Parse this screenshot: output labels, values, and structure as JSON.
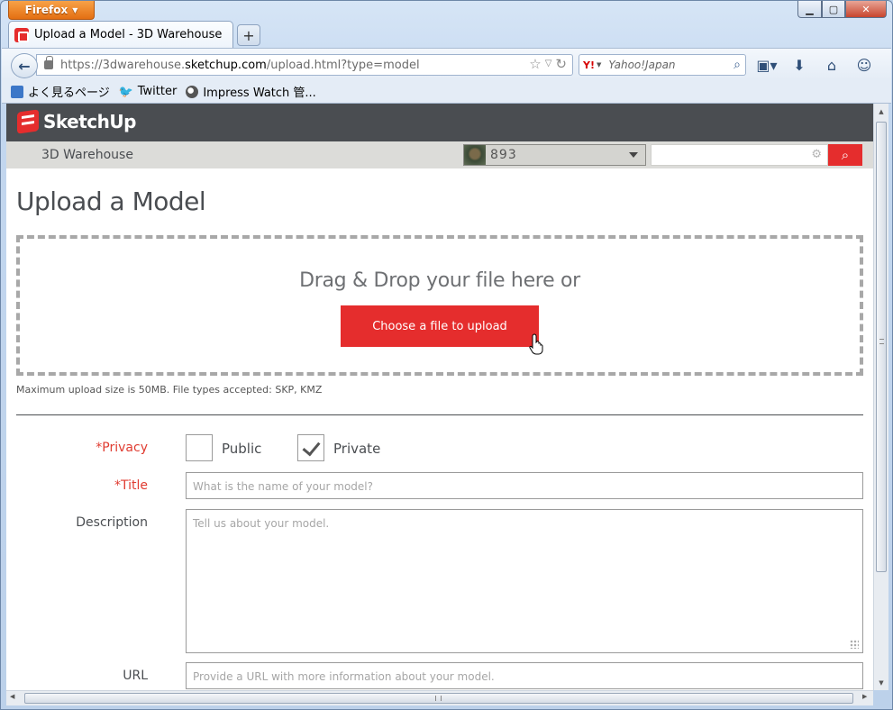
{
  "browser": {
    "menu_button": "Firefox",
    "tab_title": "Upload a Model - 3D Warehouse",
    "new_tab": "+",
    "url_prefix": "https://3dwarehouse.",
    "url_host": "sketchup.com",
    "url_path": "/upload.html?type=model",
    "search_engine": "Y!",
    "search_placeholder": "Yahoo!Japan",
    "bookmarks": [
      {
        "label": "よく見るページ",
        "icon": "bookmark-icon"
      },
      {
        "label": "Twitter",
        "icon": "twitter-icon"
      },
      {
        "label": "Impress Watch 管...",
        "icon": "impress-icon"
      }
    ]
  },
  "site": {
    "logo_text": "SketchUp",
    "section_title": "3D Warehouse",
    "user_name": "893",
    "brand_color": "#e52d2d"
  },
  "upload": {
    "page_title": "Upload a Model",
    "drop_text": "Drag & Drop your file here or",
    "choose_button": "Choose a file to upload",
    "note": "Maximum upload size is 50MB. File types accepted: SKP, KMZ"
  },
  "form": {
    "privacy_label": "*Privacy",
    "public_label": "Public",
    "public_checked": false,
    "private_label": "Private",
    "private_checked": true,
    "title_label": "*Title",
    "title_placeholder": "What is the name of your model?",
    "description_label": "Description",
    "description_placeholder": "Tell us about your model.",
    "url_label": "URL",
    "url_placeholder": "Provide a URL with more information about your model."
  }
}
